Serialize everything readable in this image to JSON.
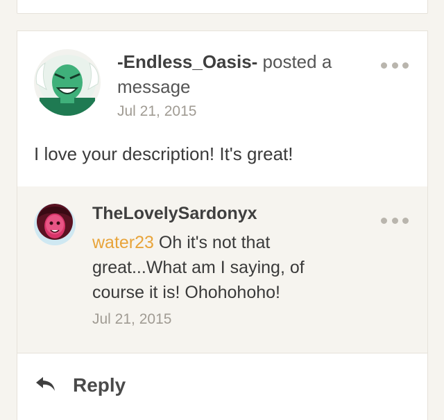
{
  "post": {
    "author": "-Endless_Oasis-",
    "action": " posted a message",
    "date": "Jul 21, 2015",
    "body": "I love your description! It's great!"
  },
  "reply": {
    "author": "TheLovelySardonyx",
    "mention": "water23",
    "text": " Oh it's not that great...What am I saying, of course it is! Ohohohoho!",
    "date": "Jul 21, 2015"
  },
  "footer": {
    "reply_label": "Reply",
    "reply_icon": "reply-arrow-icon"
  },
  "colors": {
    "mention": "#e8a43a",
    "date": "#a09b93",
    "background": "#f6f4ef"
  }
}
